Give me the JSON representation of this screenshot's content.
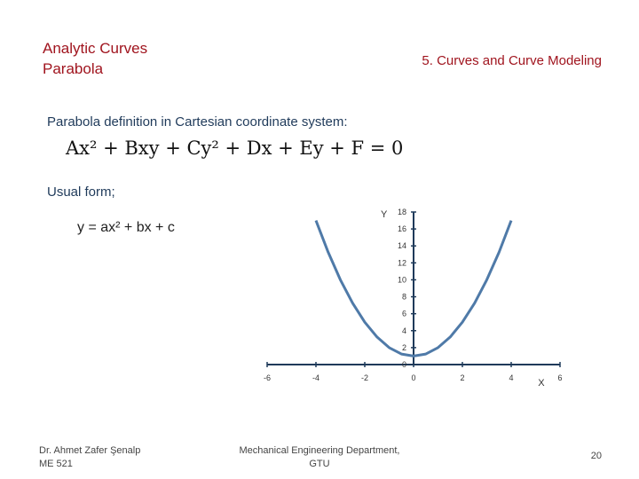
{
  "header": {
    "title_line1": "Analytic Curves",
    "title_line2": "Parabola",
    "section": "5. Curves and Curve Modeling"
  },
  "body": {
    "definition": "Parabola definition in Cartesian coordinate system:",
    "general_equation": "Ax² + Bxy + Cy² + Dx + Ey + F = 0",
    "usual_label": "Usual form;",
    "usual_equation": "y = ax² + bx + c"
  },
  "footer": {
    "author": "Dr. Ahmet Zafer Şenalp",
    "course": "ME 521",
    "department": "Mechanical Engineering Department, GTU",
    "page": "20"
  },
  "chart_data": {
    "type": "line",
    "xlabel": "X",
    "ylabel": "Y",
    "xlim": [
      -6,
      6
    ],
    "ylim": [
      0,
      18
    ],
    "xticks": [
      -6,
      -4,
      -2,
      0,
      2,
      4,
      6
    ],
    "yticks": [
      0,
      2,
      4,
      6,
      8,
      10,
      12,
      14,
      16,
      18
    ],
    "grid": false,
    "color": "#4f7aa8",
    "x": [
      -4,
      -3.5,
      -3,
      -2.5,
      -2,
      -1.5,
      -1,
      -0.5,
      0,
      0.5,
      1,
      1.5,
      2,
      2.5,
      3,
      3.5,
      4
    ],
    "y": [
      17,
      13.25,
      10,
      7.25,
      5,
      3.25,
      2,
      1.25,
      1,
      1.25,
      2,
      3.25,
      5,
      7.25,
      10,
      13.25,
      17
    ]
  }
}
